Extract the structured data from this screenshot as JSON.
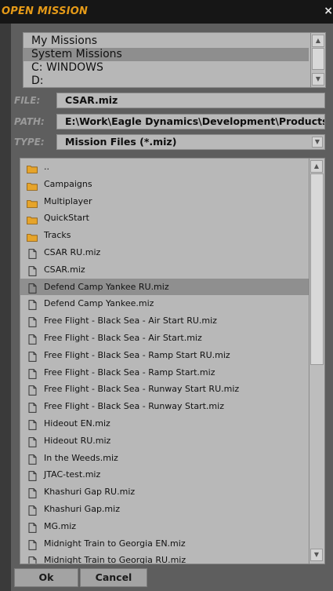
{
  "window": {
    "title": "OPEN MISSION",
    "close_glyph": "×"
  },
  "drives": {
    "items": [
      "My Missions",
      "System Missions",
      "C: WINDOWS",
      "D:"
    ],
    "selected_index": 1
  },
  "fields": {
    "file_label": "FILE:",
    "file_value": "CSAR.miz",
    "path_label": "PATH:",
    "path_value": "E:\\Work\\Eagle Dynamics\\Development\\Products\\DCS",
    "type_label": "TYPE:",
    "type_value": "Mission Files (*.miz)"
  },
  "files": {
    "selected_index": 7,
    "rows": [
      {
        "label": "..",
        "kind": "folder-icon"
      },
      {
        "label": "Campaigns",
        "kind": "folder-icon"
      },
      {
        "label": "Multiplayer",
        "kind": "folder-icon"
      },
      {
        "label": "QuickStart",
        "kind": "folder-icon"
      },
      {
        "label": "Tracks",
        "kind": "folder-icon"
      },
      {
        "label": "CSAR RU.miz",
        "kind": "file-icon"
      },
      {
        "label": "CSAR.miz",
        "kind": "file-icon"
      },
      {
        "label": "Defend Camp Yankee RU.miz",
        "kind": "file-icon"
      },
      {
        "label": "Defend Camp Yankee.miz",
        "kind": "file-icon"
      },
      {
        "label": "Free Flight - Black Sea - Air Start RU.miz",
        "kind": "file-icon"
      },
      {
        "label": "Free Flight - Black Sea - Air Start.miz",
        "kind": "file-icon"
      },
      {
        "label": "Free Flight - Black Sea - Ramp Start RU.miz",
        "kind": "file-icon"
      },
      {
        "label": "Free Flight - Black Sea - Ramp Start.miz",
        "kind": "file-icon"
      },
      {
        "label": "Free Flight - Black Sea - Runway Start RU.miz",
        "kind": "file-icon"
      },
      {
        "label": "Free Flight - Black Sea - Runway Start.miz",
        "kind": "file-icon"
      },
      {
        "label": "Hideout EN.miz",
        "kind": "file-icon"
      },
      {
        "label": "Hideout RU.miz",
        "kind": "file-icon"
      },
      {
        "label": "In the Weeds.miz",
        "kind": "file-icon"
      },
      {
        "label": "JTAC-test.miz",
        "kind": "file-icon"
      },
      {
        "label": "Khashuri Gap RU.miz",
        "kind": "file-icon"
      },
      {
        "label": "Khashuri Gap.miz",
        "kind": "file-icon"
      },
      {
        "label": "MG.miz",
        "kind": "file-icon"
      },
      {
        "label": "Midnight Train to Georgia EN.miz",
        "kind": "file-icon"
      },
      {
        "label": "Midnight Train to Georgia RU.miz",
        "kind": "file-icon"
      }
    ]
  },
  "buttons": {
    "ok": "Ok",
    "cancel": "Cancel"
  },
  "colors": {
    "title": "#e59a18",
    "folder": "#e6a42a"
  }
}
